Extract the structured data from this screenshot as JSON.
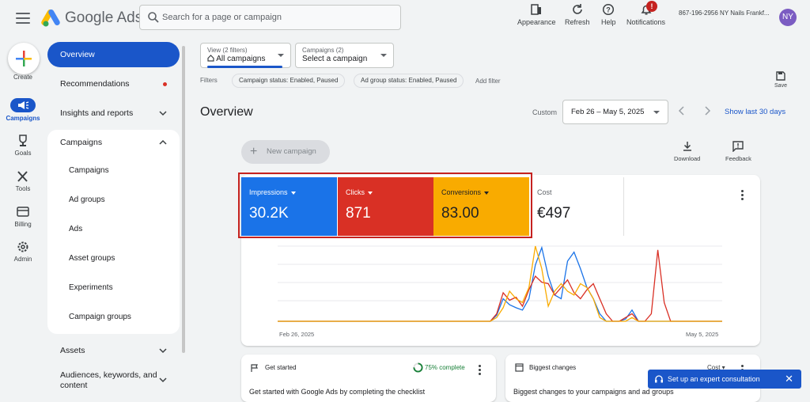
{
  "topbar": {
    "brand": "Google Ads",
    "search_placeholder": "Search for a page or campaign",
    "tools": [
      {
        "name": "appearance",
        "label": "Appearance",
        "icon": "appearance-icon"
      },
      {
        "name": "refresh",
        "label": "Refresh",
        "icon": "refresh-icon"
      },
      {
        "name": "help",
        "label": "Help",
        "icon": "help-icon"
      },
      {
        "name": "notifications",
        "label": "Notifications",
        "icon": "bell-icon",
        "badge": "!"
      }
    ],
    "account": "867-196-2956 NY Nails Frankf...",
    "avatar": "NY"
  },
  "rail": {
    "create": "Create",
    "items": [
      {
        "label": "Campaigns",
        "icon": "campaigns-icon",
        "active": true
      },
      {
        "label": "Goals",
        "icon": "trophy-icon"
      },
      {
        "label": "Tools",
        "icon": "tools-icon"
      },
      {
        "label": "Billing",
        "icon": "billing-icon"
      },
      {
        "label": "Admin",
        "icon": "gear-icon"
      }
    ]
  },
  "nav": {
    "overview": "Overview",
    "recommendations": "Recommendations",
    "insights": "Insights and reports",
    "campaigns_group": "Campaigns",
    "sub": [
      "Campaigns",
      "Ad groups",
      "Ads",
      "Asset groups",
      "Experiments",
      "Campaign groups"
    ],
    "assets": "Assets",
    "audiences": "Audiences, keywords, and",
    "audiences_2": "content"
  },
  "main": {
    "view_small": "View (2 filters)",
    "view_big": "All campaigns",
    "camp_small": "Campaigns (2)",
    "camp_big": "Select a campaign",
    "filters_label": "Filters",
    "chips": [
      "Campaign status: Enabled, Paused",
      "Ad group status: Enabled, Paused"
    ],
    "add_filter": "Add filter",
    "save": "Save",
    "title": "Overview",
    "custom": "Custom",
    "date_range": "Feb 26 – May 5, 2025",
    "show_last": "Show last 30 days",
    "new_campaign": "New campaign",
    "download": "Download",
    "feedback": "Feedback"
  },
  "metrics": [
    {
      "label": "Impressions",
      "value": "30.2K",
      "color": "#1a73e8"
    },
    {
      "label": "Clicks",
      "value": "871",
      "color": "#d93025"
    },
    {
      "label": "Conversions",
      "value": "83.00",
      "color": "#f9ab00"
    }
  ],
  "cost": {
    "label": "Cost",
    "value": "€497"
  },
  "chart_data": {
    "type": "line",
    "x_start_label": "Feb 26, 2025",
    "x_end_label": "May 5, 2025",
    "n": 70,
    "series": [
      {
        "color": "#1a73e8",
        "values": [
          0,
          0,
          0,
          0,
          0,
          0,
          0,
          0,
          0,
          0,
          0,
          0,
          0,
          0,
          0,
          0,
          0,
          0,
          0,
          0,
          0,
          0,
          0,
          0,
          0,
          0,
          0,
          0,
          0,
          0,
          0,
          0,
          0,
          0,
          8,
          30,
          22,
          18,
          15,
          30,
          75,
          98,
          60,
          35,
          30,
          80,
          92,
          70,
          45,
          30,
          10,
          0,
          0,
          0,
          3,
          15,
          0,
          0,
          0,
          0,
          0,
          0,
          0,
          0,
          0,
          0,
          0,
          0,
          0,
          0
        ]
      },
      {
        "color": "#d93025",
        "values": [
          0,
          0,
          0,
          0,
          0,
          0,
          0,
          0,
          0,
          0,
          0,
          0,
          0,
          0,
          0,
          0,
          0,
          0,
          0,
          0,
          0,
          0,
          0,
          0,
          0,
          0,
          0,
          0,
          0,
          0,
          0,
          0,
          0,
          0,
          10,
          38,
          28,
          32,
          20,
          42,
          60,
          52,
          50,
          35,
          45,
          55,
          38,
          30,
          42,
          50,
          30,
          10,
          0,
          0,
          5,
          10,
          0,
          0,
          10,
          95,
          25,
          0,
          0,
          0,
          0,
          0,
          0,
          0,
          0,
          0
        ]
      },
      {
        "color": "#f9ab00",
        "values": [
          0,
          0,
          0,
          0,
          0,
          0,
          0,
          0,
          0,
          0,
          0,
          0,
          0,
          0,
          0,
          0,
          0,
          0,
          0,
          0,
          0,
          0,
          0,
          0,
          0,
          0,
          0,
          0,
          0,
          0,
          0,
          0,
          0,
          0,
          5,
          18,
          40,
          30,
          25,
          45,
          100,
          70,
          20,
          40,
          50,
          40,
          35,
          50,
          45,
          30,
          5,
          0,
          0,
          0,
          0,
          5,
          0,
          0,
          0,
          0,
          0,
          0,
          0,
          0,
          0,
          0,
          0,
          0,
          0,
          0
        ]
      }
    ]
  },
  "bottom": {
    "get_started": "Get started",
    "complete": "75% complete",
    "get_started_sub": "Get started with Google Ads by completing the checklist",
    "biggest": "Biggest changes",
    "cost_dd": "Cost",
    "biggest_sub": "Biggest changes to your campaigns and ad groups",
    "expert": "Set up an expert consultation"
  }
}
